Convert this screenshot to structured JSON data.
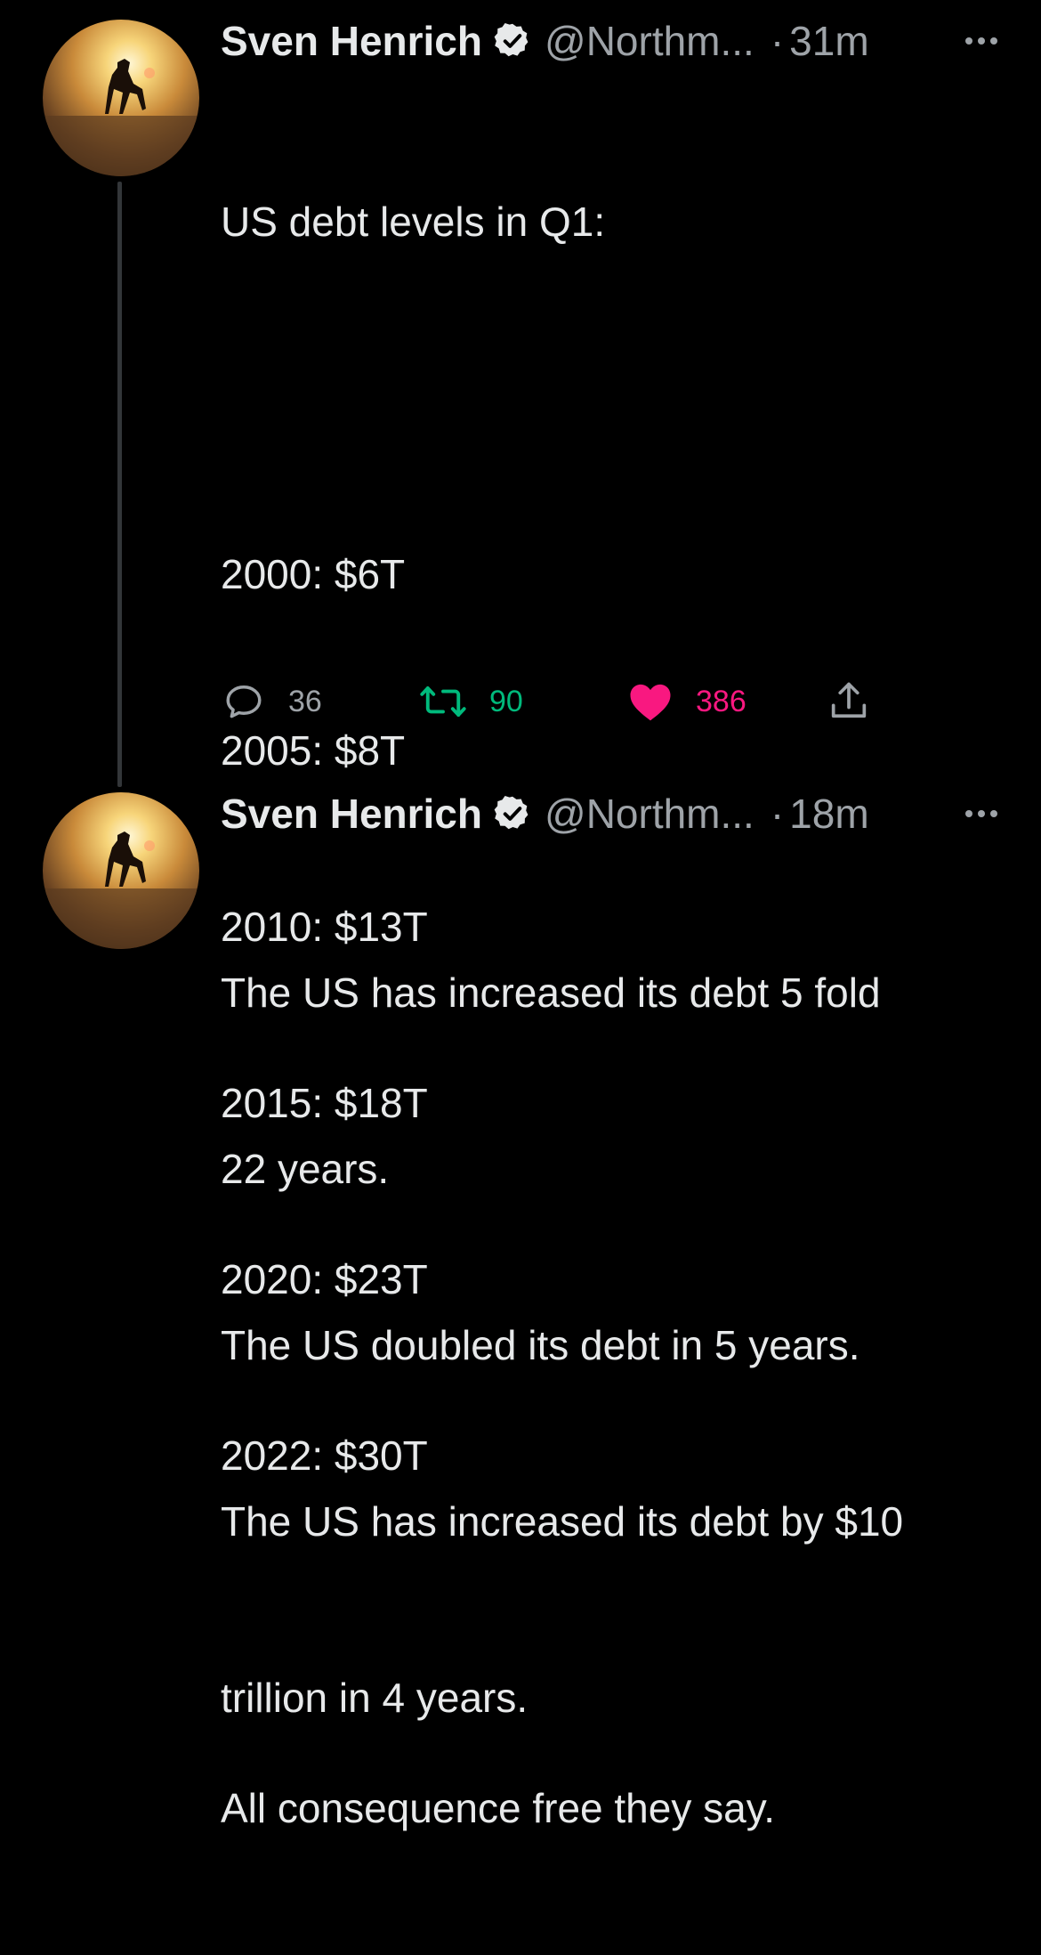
{
  "tweets": [
    {
      "author_name": "Sven Henrich",
      "handle": "@Northm...",
      "separator": "·",
      "time": "31m",
      "lines": [
        "US debt levels in Q1:",
        "",
        "2000: $6T",
        "2005: $8T",
        "2010: $13T",
        "2015: $18T",
        "2020: $23T",
        "2022: $30T",
        "",
        "All consequence free they say."
      ],
      "actions": {
        "replies": "36",
        "retweets": "90",
        "likes": "386"
      }
    },
    {
      "author_name": "Sven Henrich",
      "handle": "@Northm...",
      "separator": "·",
      "time": "18m",
      "lines": [
        "The US has increased its debt 5 fold",
        "22 years.",
        "The US doubled its debt in 5 years.",
        "The US has increased its debt by $10",
        "trillion in 4 years."
      ]
    }
  ],
  "colors": {
    "background": "#000000",
    "text": "#e7e9ea",
    "muted": "#9ea3a8",
    "retweet_active": "#00ba7c",
    "like_active": "#f91880",
    "thread_line": "#333639"
  },
  "icons": {
    "reply": "speech-bubble-outline",
    "retweet": "retweet-arrows",
    "like": "heart-filled",
    "share": "upload-arrow",
    "verified": "verified-badge",
    "more": "three-dots"
  }
}
